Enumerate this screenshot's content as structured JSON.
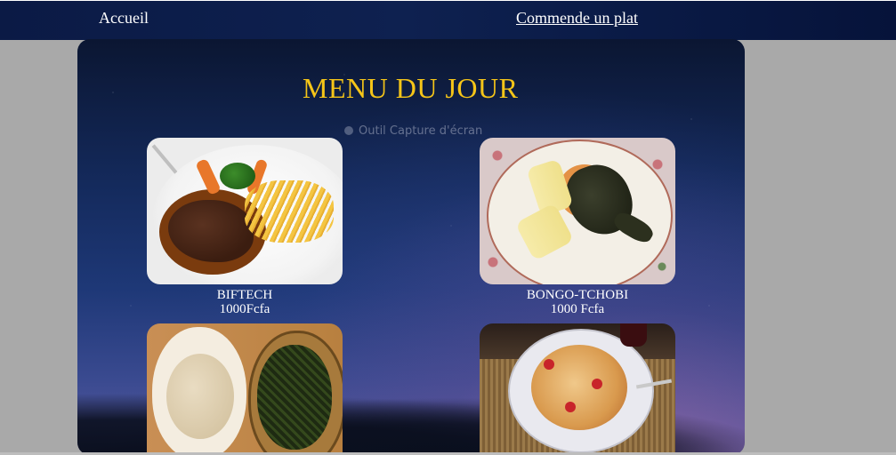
{
  "nav": {
    "home_label": "Accueil",
    "order_label": "Commende un plat"
  },
  "main": {
    "title": "MENU DU JOUR",
    "overlay_text": "Outil Capture d'écran",
    "dishes": [
      {
        "name": "BIFTECH",
        "price": "1000Fcfa",
        "photo": "steak-fries-photo"
      },
      {
        "name": "BONGO-TCHOBI",
        "price": "1000 Fcfa",
        "photo": "fish-yam-photo"
      },
      {
        "name": "",
        "price": "",
        "photo": "fufu-leaf-sauce-photo"
      },
      {
        "name": "",
        "price": "",
        "photo": "pasta-photo"
      }
    ]
  },
  "colors": {
    "title": "#f5c518",
    "nav_bg": "#0b1a45",
    "page_bg": "#a9a9a9"
  }
}
